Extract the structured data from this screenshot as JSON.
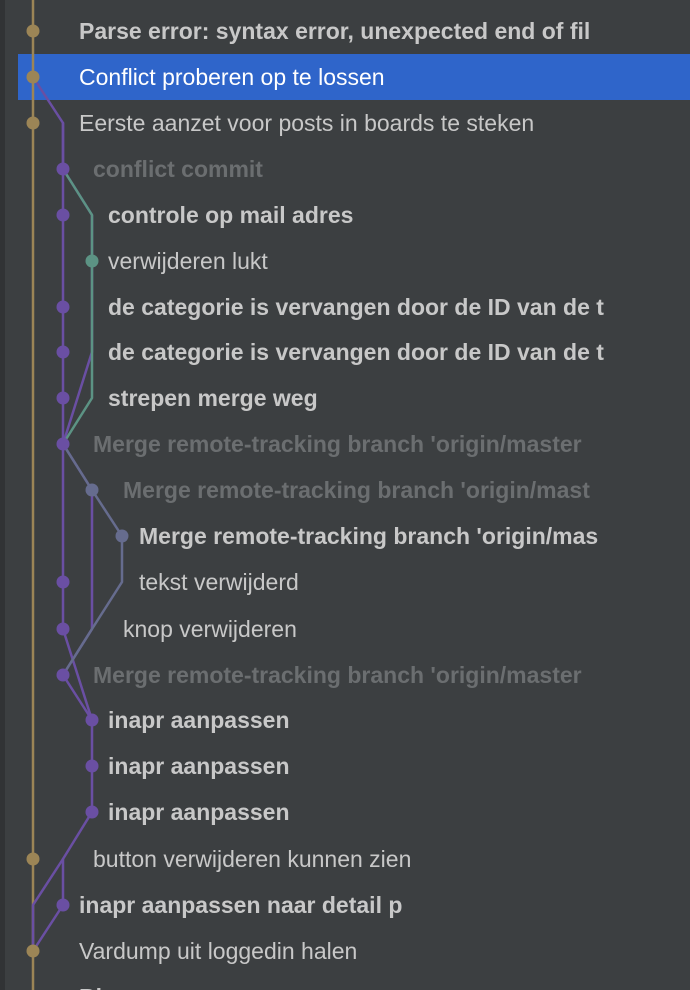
{
  "commits": [
    "Parse error: syntax error, unexpected end of fil",
    "Conflict proberen op te lossen",
    "Eerste aanzet voor posts in boards te steken",
    "conflict commit",
    "controle op mail adres",
    "verwijderen lukt",
    "de categorie is vervangen door de ID van de t",
    "de categorie is vervangen door de ID van de t",
    "strepen merge weg",
    "Merge remote-tracking branch 'origin/master",
    "Merge remote-tracking branch 'origin/mast",
    "Merge remote-tracking branch 'origin/mas",
    "tekst verwijderd",
    "knop verwijderen",
    "Merge remote-tracking branch 'origin/master",
    "inapr aanpassen",
    "inapr aanpassen",
    "inapr aanpassen",
    "button verwijderen kunnen zien",
    "inapr aanpassen naar detail p",
    "Vardump uit loggedin halen",
    "Bl"
  ],
  "colors": {
    "gold": "#9c8556",
    "purple": "#6a4fa3",
    "teal": "#5c9384",
    "slate": "#666c8e"
  }
}
